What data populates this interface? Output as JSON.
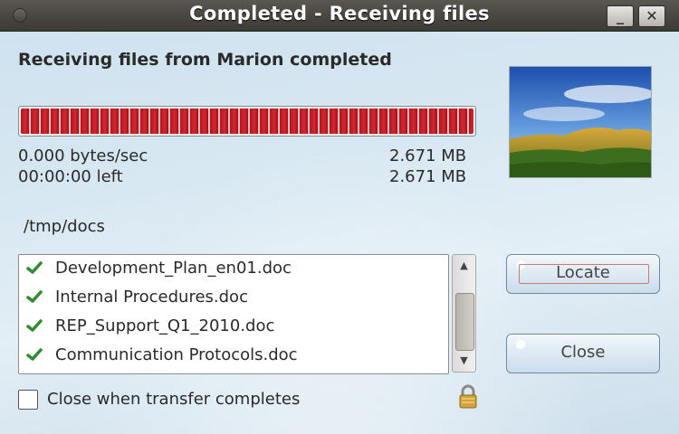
{
  "window": {
    "title": "Completed - Receiving files",
    "minimize_glyph": "_",
    "close_glyph": "✕"
  },
  "header": {
    "text": "Receiving files from Marion completed"
  },
  "progress": {
    "fraction": 1.0,
    "speed": "0.000 bytes/sec",
    "transferred": "2.671 MB",
    "time_left": "00:00:00 left",
    "total": "2.671 MB"
  },
  "folder": "/tmp/docs",
  "files": [
    {
      "name": "Development_Plan_en01.doc",
      "icon": "check-icon"
    },
    {
      "name": "Internal Procedures.doc",
      "icon": "check-icon"
    },
    {
      "name": "REP_Support_Q1_2010.doc",
      "icon": "check-icon"
    },
    {
      "name": "Communication Protocols.doc",
      "icon": "check-icon"
    }
  ],
  "buttons": {
    "locate": "Locate",
    "close": "Close"
  },
  "options": {
    "close_when_complete": "Close when transfer completes",
    "close_when_complete_checked": false
  },
  "colors": {
    "progress": "#c0141e",
    "check": "#2e8b2e"
  },
  "icons": {
    "lock": "lock-icon",
    "scroll_up": "chevron-up-icon",
    "scroll_down": "chevron-down-icon"
  }
}
